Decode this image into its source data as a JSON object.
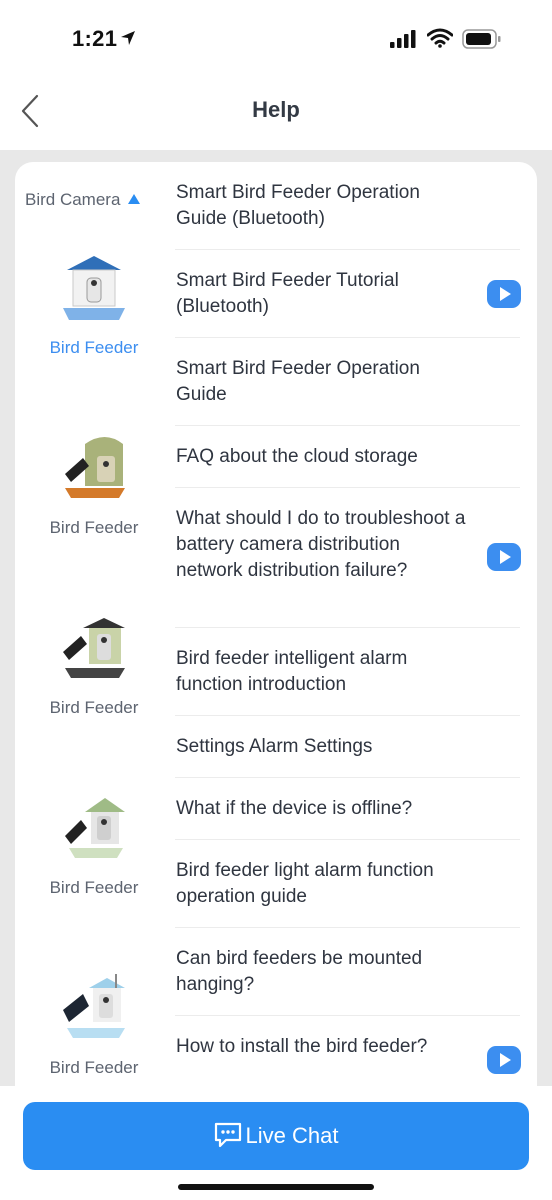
{
  "status_bar": {
    "time": "1:21"
  },
  "nav": {
    "title": "Help"
  },
  "category": {
    "label": "Bird Camera"
  },
  "devices": [
    {
      "label": "Bird Feeder",
      "active": true
    },
    {
      "label": "Bird Feeder",
      "active": false
    },
    {
      "label": "Bird Feeder",
      "active": false
    },
    {
      "label": "Bird Feeder",
      "active": false
    },
    {
      "label": "Bird Feeder",
      "active": false
    }
  ],
  "faq": [
    {
      "text": "Smart Bird Feeder Operation Guide (Bluetooth)",
      "video": false
    },
    {
      "text": "Smart Bird Feeder Tutorial (Bluetooth)",
      "video": true
    },
    {
      "text": "Smart Bird Feeder Operation Guide",
      "video": false
    },
    {
      "text": "FAQ about the cloud storage",
      "video": false
    },
    {
      "text": "What should I do to troubleshoot a battery camera distribution network distribution failure?",
      "video": true
    },
    {
      "text": "Bird feeder intelligent alarm function introduction",
      "video": false
    },
    {
      "text": "Settings Alarm Settings",
      "video": false
    },
    {
      "text": "What if the device is offline?",
      "video": false
    },
    {
      "text": "Bird feeder light alarm function operation guide",
      "video": false
    },
    {
      "text": "Can bird feeders be mounted hanging?",
      "video": false
    },
    {
      "text": "How to install the bird feeder?",
      "video": true
    }
  ],
  "live_chat": {
    "label": "Live Chat"
  },
  "colors": {
    "accent": "#3c8ef0",
    "button": "#2a8df2",
    "background": "#e8e8e8"
  }
}
